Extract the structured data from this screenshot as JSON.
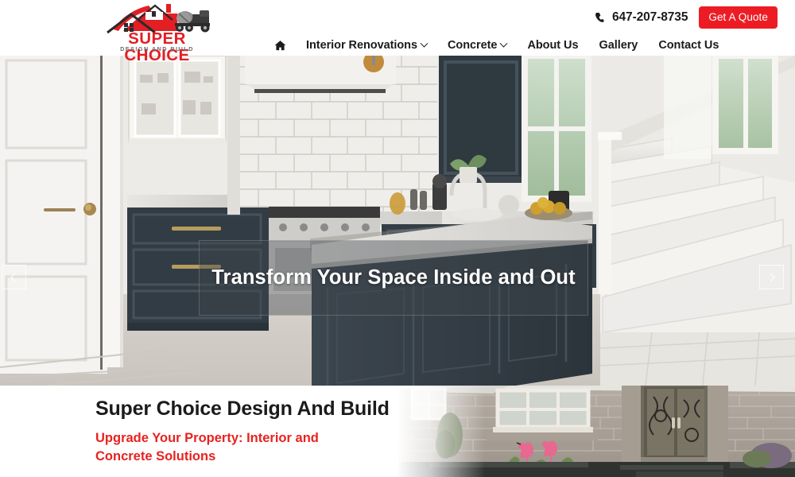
{
  "header": {
    "logo": {
      "name": "SUPER CHOICE",
      "tagline": "DESIGN AND BUILD",
      "icon": "house-concrete-mixer-logo",
      "red": "#e31e24"
    },
    "phone": {
      "icon": "phone-icon",
      "number": "647-207-8735"
    },
    "quote_button": {
      "label": "Get A Quote",
      "color": "#ed1c24"
    },
    "nav": [
      {
        "label": "",
        "icon": "home-icon",
        "has_dropdown": false
      },
      {
        "label": "Interior Renovations",
        "icon": "",
        "has_dropdown": true
      },
      {
        "label": "Concrete",
        "icon": "",
        "has_dropdown": true
      },
      {
        "label": "About Us",
        "icon": "",
        "has_dropdown": false
      },
      {
        "label": "Gallery",
        "icon": "",
        "has_dropdown": false
      },
      {
        "label": "Contact Us",
        "icon": "",
        "has_dropdown": false
      }
    ]
  },
  "hero": {
    "caption": "Transform Your Space Inside and Out",
    "image_alt": "modern kitchen with dark navy island, white subway tile backsplash and white staircase",
    "prev_label": "‹",
    "next_label": "›",
    "prev_icon": "chevron-left-icon",
    "next_icon": "chevron-right-icon"
  },
  "section": {
    "title": "Super Choice Design And Build",
    "subtitle": "Upgrade Your Property: Interior and Concrete Solutions",
    "subtitle_color": "#e8221f",
    "image_alt": "stone house facade with double front door and pink flamingo garden ornaments"
  }
}
